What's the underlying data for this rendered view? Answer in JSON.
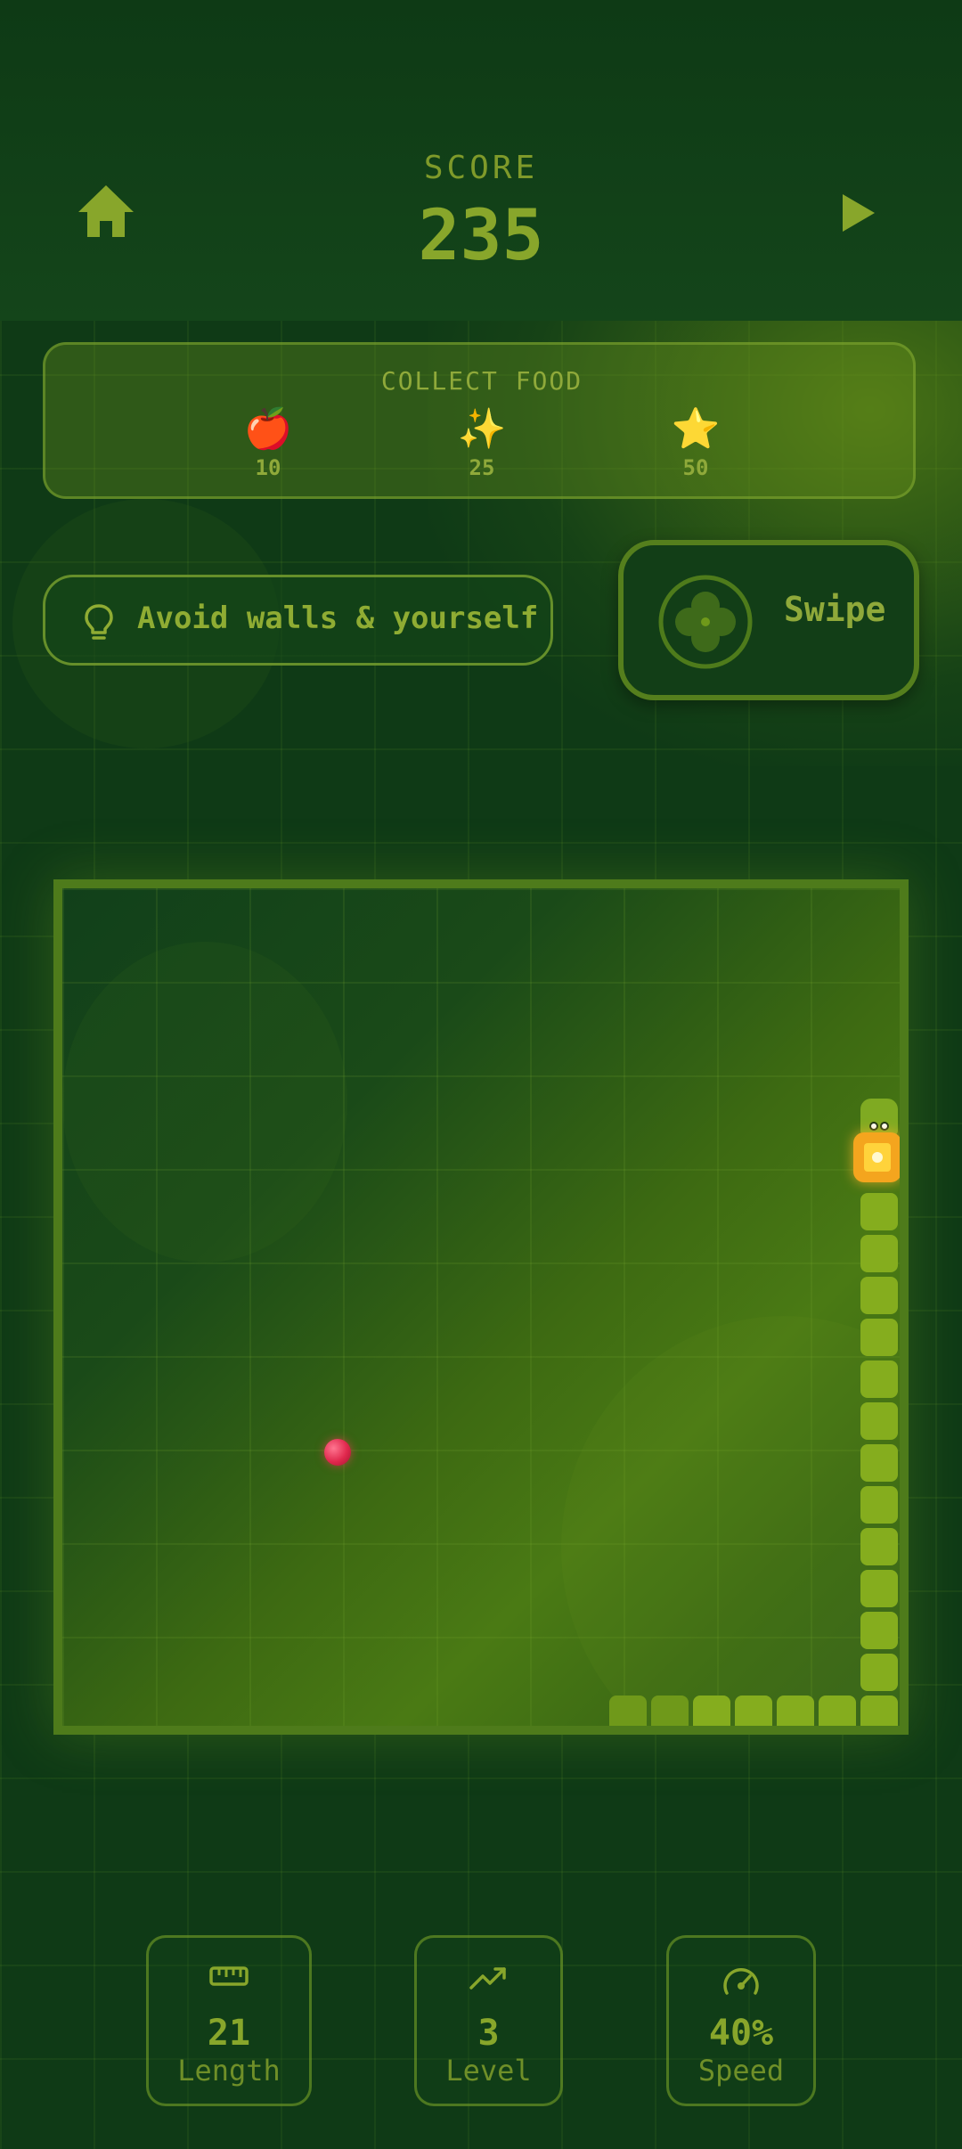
{
  "header": {
    "score_label": "SCORE",
    "score_value": "235",
    "home_icon": "home-icon",
    "play_icon": "play-icon"
  },
  "food_legend": {
    "title": "COLLECT FOOD",
    "items": [
      {
        "emoji": "🍎",
        "icon": "apple-icon",
        "points": "10"
      },
      {
        "emoji": "✨",
        "icon": "sparkles-icon",
        "points": "25"
      },
      {
        "emoji": "⭐",
        "icon": "star-icon",
        "points": "50"
      }
    ]
  },
  "hint": {
    "icon": "lightbulb-icon",
    "text": "Avoid walls & yourself"
  },
  "control": {
    "icon": "swipe-pad-icon",
    "label": "Swipe"
  },
  "stats": [
    {
      "icon": "ruler-icon",
      "value": "21",
      "label": "Length"
    },
    {
      "icon": "trending-up-icon",
      "value": "3",
      "label": "Level"
    },
    {
      "icon": "speedometer-icon",
      "value": "40%",
      "label": "Speed"
    }
  ],
  "colors": {
    "background": "#0f3a16",
    "accent": "#88a62b",
    "snake": "#85ad1e",
    "bonus_food": "#f4a51e",
    "apple": "#e0284d"
  }
}
